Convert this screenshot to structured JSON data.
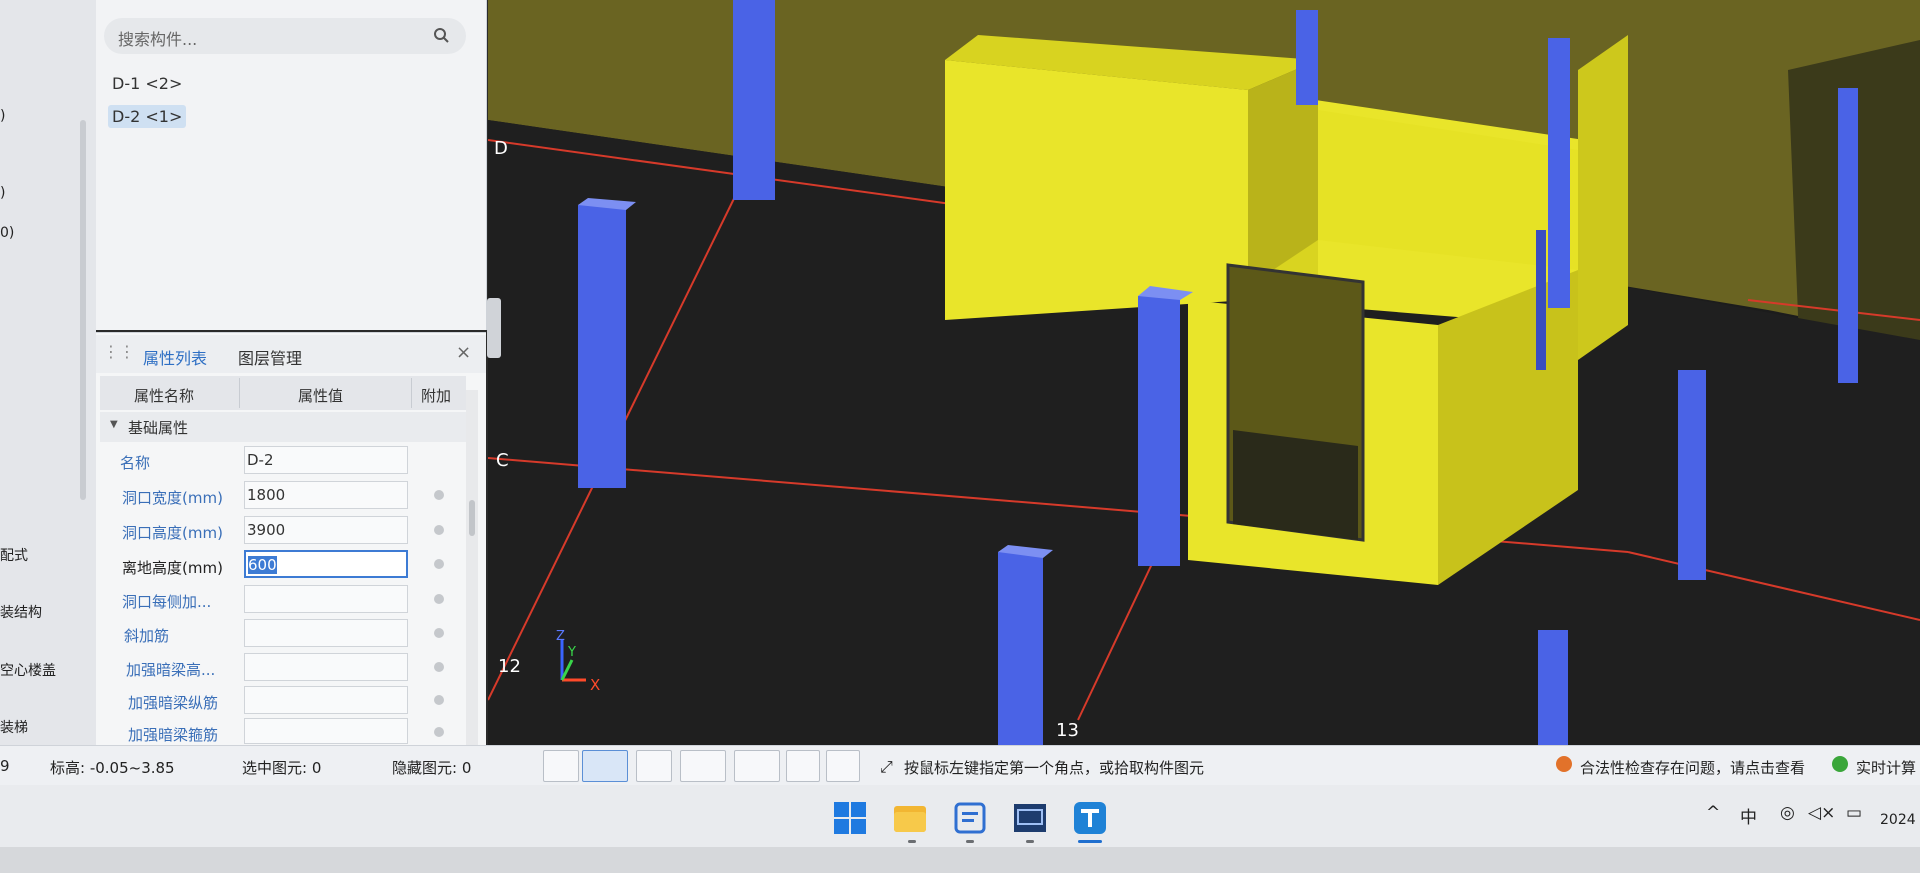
{
  "left_strip": {
    "fragments": [
      ")",
      ")",
      "0)",
      "配式",
      "装结构",
      "空心楼盖",
      "装梯",
      "9"
    ]
  },
  "components": {
    "search_placeholder": "搜索构件...",
    "items": [
      {
        "label": "D-1 <2>",
        "selected": false
      },
      {
        "label": "D-2 <1>",
        "selected": true
      }
    ]
  },
  "properties": {
    "tabs": [
      "属性列表",
      "图层管理"
    ],
    "close_label": "×",
    "headers": {
      "name": "属性名称",
      "value": "属性值",
      "extra": "附加"
    },
    "group": "基础属性",
    "rows": [
      {
        "name": "名称",
        "value": "D-2"
      },
      {
        "name": "洞口宽度(mm)",
        "value": "1800"
      },
      {
        "name": "洞口高度(mm)",
        "value": "3900"
      },
      {
        "name": "离地高度(mm)",
        "value": "600"
      },
      {
        "name": "洞口每侧加...",
        "value": ""
      },
      {
        "name": "斜加筋",
        "value": ""
      },
      {
        "name": "加强暗梁高...",
        "value": ""
      },
      {
        "name": "加强暗梁纵筋",
        "value": ""
      },
      {
        "name": "加强暗梁箍筋",
        "value": ""
      }
    ]
  },
  "view3d": {
    "axis_labels": {
      "d": "D",
      "c": "C",
      "n12": "12",
      "n13": "13"
    },
    "gizmo": {
      "z": "Z",
      "y": "Y",
      "x": "X"
    }
  },
  "status": {
    "elevation": "标高: -0.05~3.85",
    "selected": "选中图元: 0",
    "hidden": "隐藏图元: 0",
    "hint": "按鼠标左键指定第一个角点，或拾取构件图元",
    "warning": "合法性检查存在问题，请点击查看",
    "realtime": "实时计算"
  },
  "taskbar": {
    "ime": "中",
    "year": "2024"
  },
  "colors": {
    "wall": "#e9e52a",
    "column": "#4a63e6",
    "axis_line": "#d63a2a",
    "accent": "#3d7bd4"
  }
}
